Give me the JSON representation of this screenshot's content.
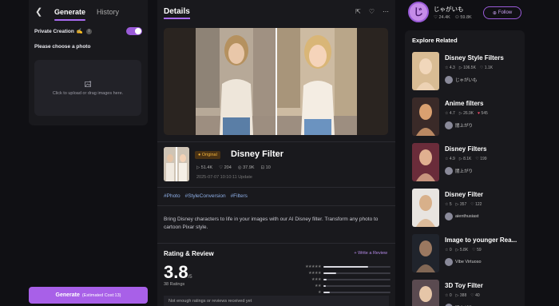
{
  "left": {
    "tabs": [
      "Generate",
      "History"
    ],
    "private_label": "Private Creation",
    "private_icon": "✍",
    "choose_label": "Please choose a photo",
    "upload_hint": "Click to upload or drag images here.",
    "generate_label": "Generate",
    "generate_cost": "(Estimated Cost:13)"
  },
  "center": {
    "title": "Details",
    "badge": "Original",
    "filter_name": "Disney Filter",
    "stats": [
      "51.4K",
      "204",
      "37.9K",
      "10"
    ],
    "date": "2025-07-07 10:10:11 Update",
    "tags": [
      "#Photo",
      "#StyleConversion",
      "#Filters"
    ],
    "description": "Bring Disney characters to life in your images with our AI Disney filter. Transform any photo to cartoon Pixar style.",
    "rating_title": "Rating & Review",
    "write_review": "+ Write a Review",
    "score": "3.8",
    "score_max": "/5",
    "ratings_count": "38 Ratings",
    "not_enough": "Not enough ratings or reviews received yet",
    "rating_bars": [
      0.67,
      0.19,
      0.05,
      0.03,
      0.09
    ]
  },
  "user": {
    "avatar_char": "じ",
    "name": "じゃがいも",
    "likes": "24.4K",
    "followers": "59.8K",
    "follow_label": "Follow"
  },
  "explore": {
    "title": "Explore Related",
    "items": [
      {
        "title": "Disney Style Filters",
        "rating": "4.3",
        "views": "106.5K",
        "likes": "1.1K",
        "author": "じゃがいも"
      },
      {
        "title": "Anime filters",
        "rating": "4.7",
        "views": "26.9K",
        "likes": "545",
        "author": "闇上がり"
      },
      {
        "title": "Disney Filters",
        "rating": "4.9",
        "views": "8.1K",
        "likes": "199",
        "author": "闇上がり"
      },
      {
        "title": "Disney Filter",
        "rating": "5",
        "views": "357",
        "likes": "122",
        "author": "aienthusiast"
      },
      {
        "title": "Image to younger Rea...",
        "rating": "0",
        "views": "5.8K",
        "likes": "59",
        "author": "Vibe Virtuoso"
      },
      {
        "title": "3D Toy Filter",
        "rating": "0",
        "views": "388",
        "likes": "40",
        "author": "闇上がり"
      }
    ]
  },
  "colors": {
    "accent": "#a860e8",
    "badge_text": "#f0b23b",
    "tag": "#8fb0e8"
  }
}
